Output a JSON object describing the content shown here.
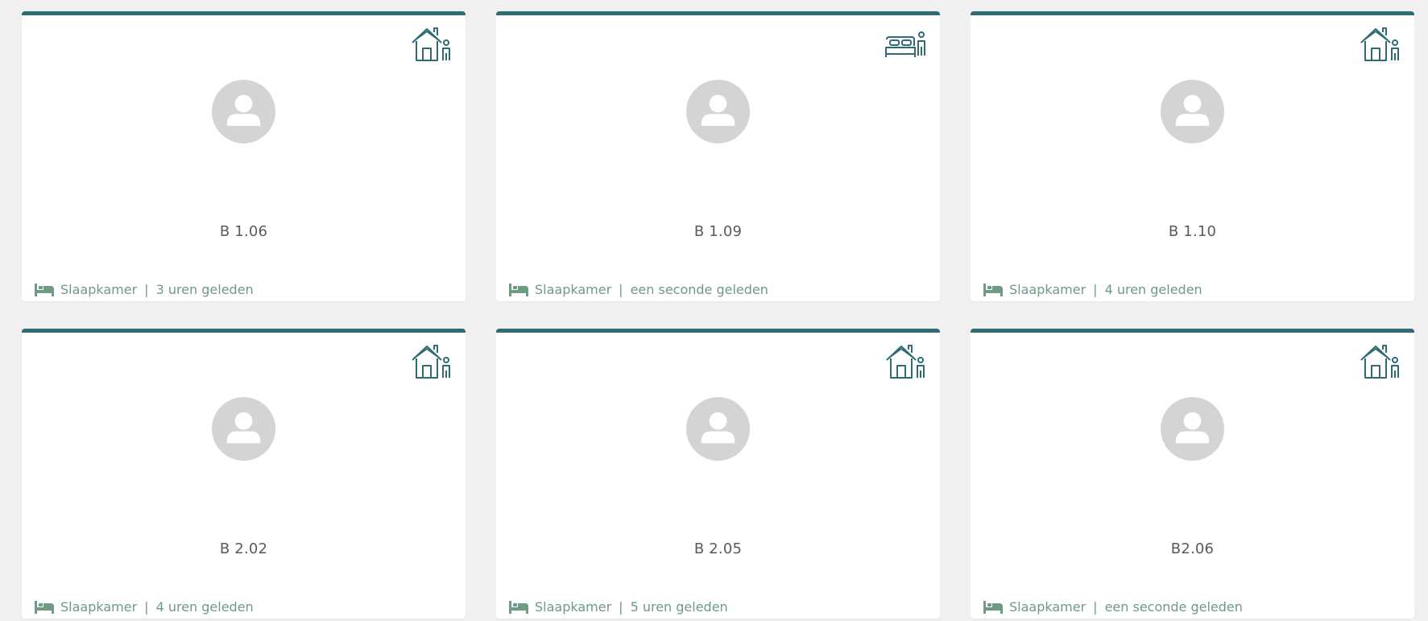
{
  "cards": [
    {
      "room": "B 1.06",
      "status_icon": "house-person-icon",
      "location": "Slaapkamer",
      "separator": "|",
      "time": "3 uren geleden",
      "location_icon": "bed-icon"
    },
    {
      "room": "B 1.09",
      "status_icon": "bed-person-icon",
      "location": "Slaapkamer",
      "separator": "|",
      "time": "een seconde geleden",
      "location_icon": "bed-icon"
    },
    {
      "room": "B 1.10",
      "status_icon": "house-person-icon",
      "location": "Slaapkamer",
      "separator": "|",
      "time": "4 uren geleden",
      "location_icon": "bed-icon"
    },
    {
      "room": "B 2.02",
      "status_icon": "house-person-icon",
      "location": "Slaapkamer",
      "separator": "|",
      "time": "4 uren geleden",
      "location_icon": "bed-icon"
    },
    {
      "room": "B 2.05",
      "status_icon": "house-person-icon",
      "location": "Slaapkamer",
      "separator": "|",
      "time": "5 uren geleden",
      "location_icon": "bed-icon"
    },
    {
      "room": "B2.06",
      "status_icon": "house-person-icon",
      "location": "Slaapkamer",
      "separator": "|",
      "time": "een seconde geleden",
      "location_icon": "bed-icon"
    }
  ],
  "colors": {
    "accent": "#2e6b72",
    "footer_text": "#6f9a84",
    "avatar_bg": "#d4d4d4",
    "page_bg": "#f0f0f0"
  }
}
